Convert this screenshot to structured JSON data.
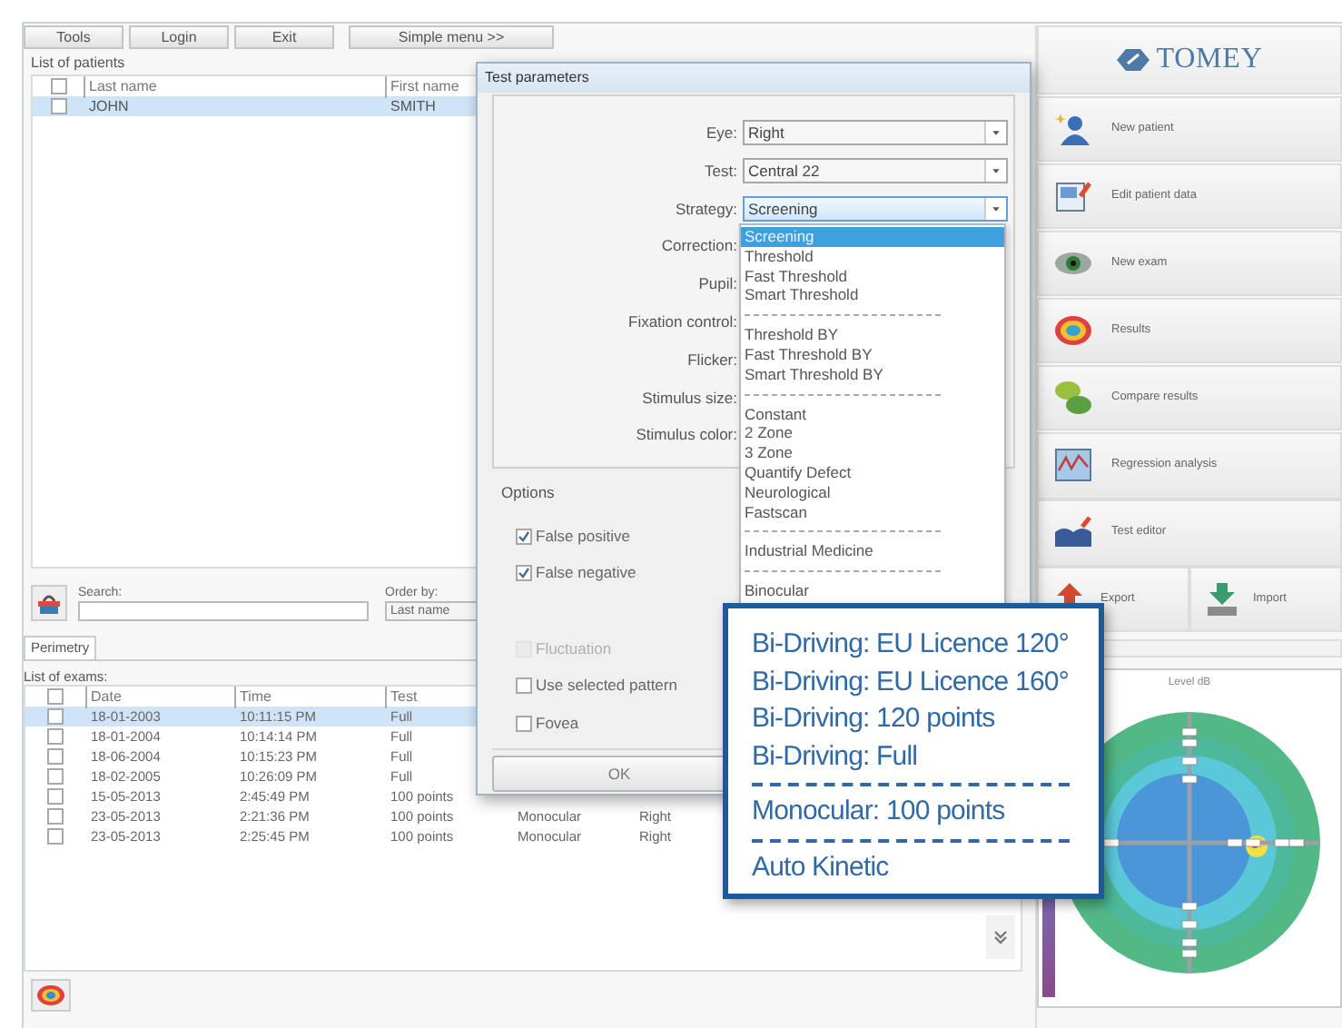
{
  "toolbar": [
    "Tools",
    "Login",
    "Exit",
    "Simple menu >>"
  ],
  "patients": {
    "title": "List of patients",
    "header_checked": false,
    "columns": [
      "Last name",
      "First name"
    ],
    "rows": [
      {
        "cells": [
          "JOHN",
          "SMITH"
        ],
        "selected": true,
        "checked": false
      }
    ]
  },
  "search": {
    "label": "Search:",
    "order_label": "Order by:",
    "order_value": "Last name"
  },
  "tabs": [
    {
      "label": "Perimetry",
      "selected": true
    }
  ],
  "exams": {
    "title": "List of exams:",
    "header_checked": false,
    "columns": [
      "Date",
      "Time",
      "Test"
    ],
    "rows": [
      {
        "cells": [
          "18-01-2003",
          "10:11:15 PM",
          "Full"
        ],
        "selected": true,
        "checked": false
      },
      {
        "cells": [
          "18-01-2004",
          "10:14:14 PM",
          "Full"
        ],
        "selected": false,
        "checked": false
      },
      {
        "cells": [
          "18-06-2004",
          "10:15:23 PM",
          "Full"
        ],
        "selected": false,
        "checked": false
      },
      {
        "cells": [
          "18-02-2005",
          "10:26:09 PM",
          "Full"
        ],
        "selected": false,
        "checked": false
      },
      {
        "cells": [
          "15-05-2013",
          "2:45:49 PM",
          "100 points"
        ],
        "selected": false,
        "checked": false
      },
      {
        "cells": [
          "23-05-2013",
          "2:21:36 PM",
          "100 points",
          "Monocular",
          "Right"
        ],
        "selected": false,
        "checked": false
      },
      {
        "cells": [
          "23-05-2013",
          "2:25:45 PM",
          "100 points",
          "Monocular",
          "Right"
        ],
        "selected": false,
        "checked": false
      }
    ]
  },
  "menu": {
    "logo": "TOMEY",
    "buttons": [
      "New patient",
      "Edit patient data",
      "New exam",
      "Results",
      "Compare results",
      "Regression analysis",
      "Test editor"
    ],
    "bottom_buttons": [
      "Export",
      "Import"
    ]
  },
  "chart": {
    "title": "Level dB"
  },
  "dialog": {
    "title": "Test parameters",
    "fields": [
      {
        "label": "Eye:",
        "value": "Right"
      },
      {
        "label": "Test:",
        "value": "Central 22"
      },
      {
        "label": "Strategy:",
        "value": "Screening"
      },
      {
        "label": "Correction:"
      },
      {
        "label": "Pupil:"
      },
      {
        "label": "Fixation control:"
      },
      {
        "label": "Flicker:"
      },
      {
        "label": "Stimulus size:"
      },
      {
        "label": "Stimulus color:"
      }
    ],
    "options_title": "Options",
    "options": [
      {
        "label": "False positive",
        "checked": true,
        "disabled": false
      },
      {
        "label": "False negative",
        "checked": true,
        "disabled": false
      },
      {
        "label": "Fluctuation",
        "checked": false,
        "disabled": true
      },
      {
        "label": "Use selected pattern",
        "checked": false,
        "disabled": false
      },
      {
        "label": "Fovea",
        "checked": false,
        "disabled": false
      }
    ],
    "ok": "OK"
  },
  "dropdown": [
    {
      "kind": "option",
      "label": "Screening",
      "selected": true
    },
    {
      "kind": "option",
      "label": "Threshold",
      "selected": false
    },
    {
      "kind": "option",
      "label": "Fast Threshold",
      "selected": false
    },
    {
      "kind": "option",
      "label": "Smart Threshold",
      "selected": false
    },
    {
      "kind": "separator"
    },
    {
      "kind": "option",
      "label": "Threshold BY",
      "selected": false
    },
    {
      "kind": "option",
      "label": "Fast Threshold BY",
      "selected": false
    },
    {
      "kind": "option",
      "label": "Smart Threshold BY",
      "selected": false
    },
    {
      "kind": "separator"
    },
    {
      "kind": "option",
      "label": "Constant",
      "selected": false
    },
    {
      "kind": "option",
      "label": "2 Zone",
      "selected": false
    },
    {
      "kind": "option",
      "label": "3 Zone",
      "selected": false
    },
    {
      "kind": "option",
      "label": "Quantify Defect",
      "selected": false
    },
    {
      "kind": "option",
      "label": "Neurological",
      "selected": false
    },
    {
      "kind": "option",
      "label": "Fastscan",
      "selected": false
    },
    {
      "kind": "separator"
    },
    {
      "kind": "option",
      "label": "Industrial Medicine",
      "selected": false
    },
    {
      "kind": "separator"
    },
    {
      "kind": "option",
      "label": "Binocular",
      "selected": false
    }
  ],
  "callout": [
    {
      "kind": "line",
      "text": "Bi-Driving: EU Licence 120°"
    },
    {
      "kind": "line",
      "text": "Bi-Driving: EU Licence 160°"
    },
    {
      "kind": "line",
      "text": "Bi-Driving: 120 points"
    },
    {
      "kind": "line",
      "text": "Bi-Driving: Full"
    },
    {
      "kind": "separator"
    },
    {
      "kind": "line",
      "text": "Monocular: 100 points"
    },
    {
      "kind": "separator"
    },
    {
      "kind": "line",
      "text": "Auto Kinetic"
    }
  ]
}
